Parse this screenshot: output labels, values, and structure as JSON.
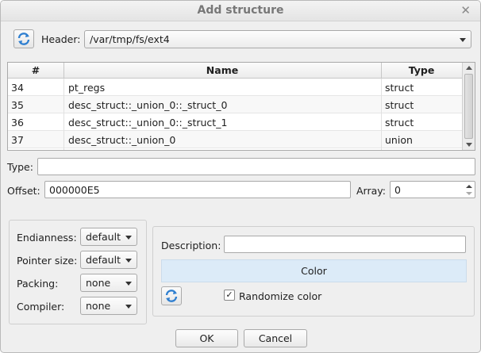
{
  "window": {
    "title": "Add structure"
  },
  "icons": {
    "refresh": "refresh-icon",
    "close": "close-icon",
    "checkmark": "checkmark-icon"
  },
  "header": {
    "label": "Header:",
    "value": "/var/tmp/fs/ext4"
  },
  "table": {
    "columns": [
      "#",
      "Name",
      "Type"
    ],
    "rows": [
      {
        "num": "34",
        "name": "pt_regs",
        "type": "struct"
      },
      {
        "num": "35",
        "name": "desc_struct::_union_0::_struct_0",
        "type": "struct"
      },
      {
        "num": "36",
        "name": "desc_struct::_union_0::_struct_1",
        "type": "struct"
      },
      {
        "num": "37",
        "name": "desc_struct::_union_0",
        "type": "union"
      }
    ]
  },
  "type_field": {
    "label": "Type:",
    "value": ""
  },
  "offset_field": {
    "label": "Offset:",
    "value": "000000E5"
  },
  "array_field": {
    "label": "Array:",
    "value": "0"
  },
  "settings": {
    "endianness": {
      "label": "Endianness:",
      "value": "default"
    },
    "pointer_size": {
      "label": "Pointer size:",
      "value": "default"
    },
    "packing": {
      "label": "Packing:",
      "value": "none"
    },
    "compiler": {
      "label": "Compiler:",
      "value": "none"
    }
  },
  "description": {
    "label": "Description:",
    "value": ""
  },
  "color": {
    "label": "Color",
    "fill": "#dcebf8"
  },
  "randomize": {
    "label": "Randomize color",
    "checked": true,
    "mark": "✓"
  },
  "buttons": {
    "ok": "OK",
    "cancel": "Cancel"
  }
}
